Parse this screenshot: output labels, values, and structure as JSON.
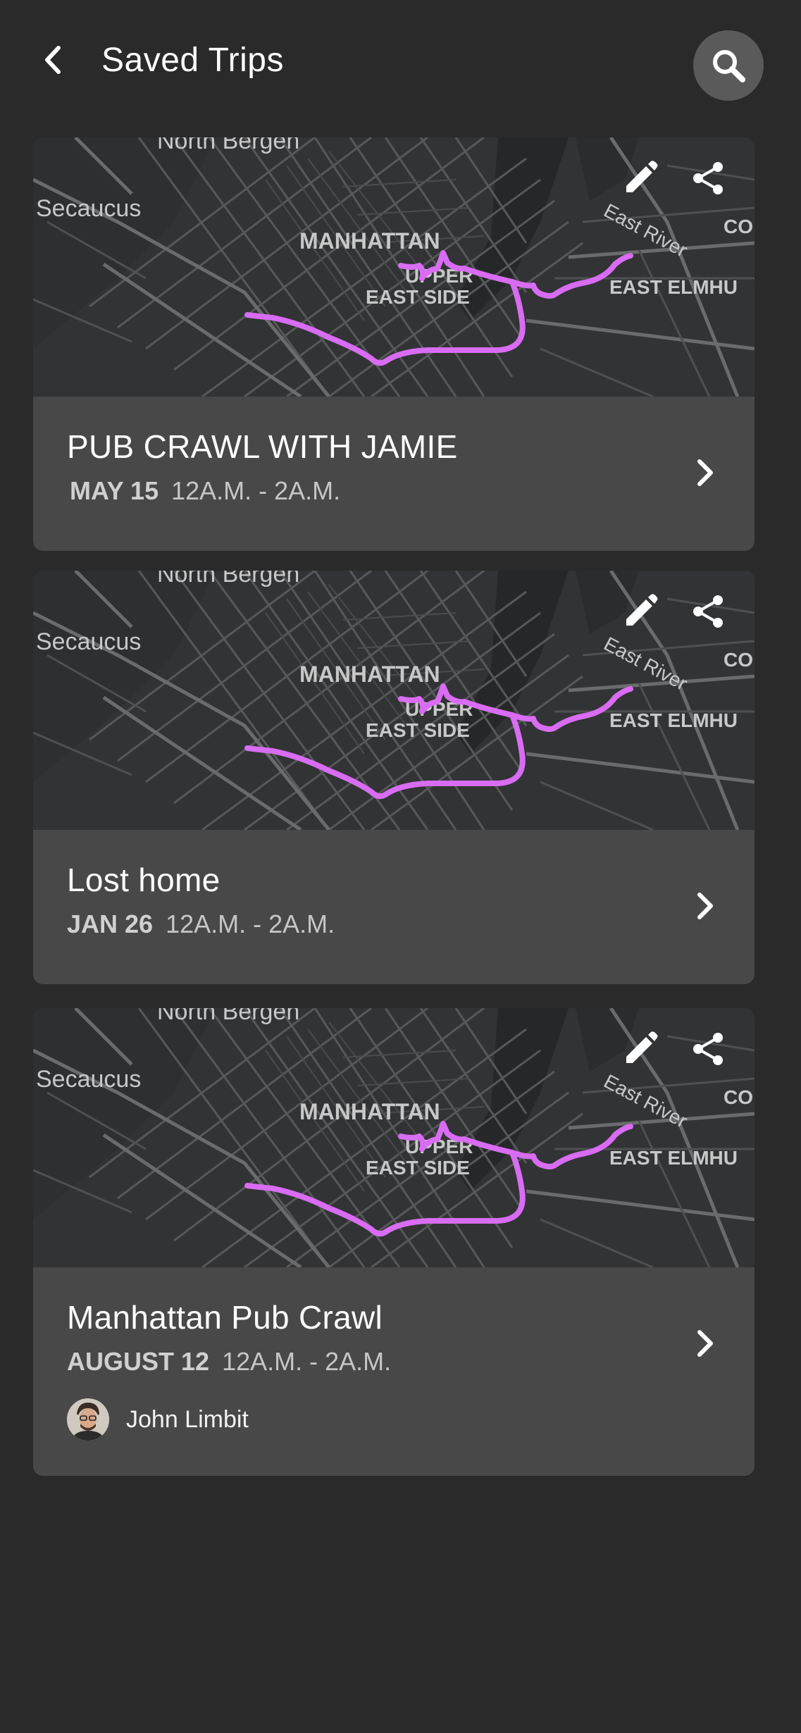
{
  "header": {
    "title": "Saved Trips"
  },
  "map_labels": {
    "north": "North Bergen",
    "west": "Secaucus",
    "borough": "MANHATTAN",
    "neigh_1": "UPPER",
    "neigh_2": "EAST SIDE",
    "river": "East River",
    "east": "EAST ELMHU",
    "edge": "CO"
  },
  "colors": {
    "route": "#d86cf2",
    "background": "#2a2a2a",
    "card": "#484848"
  },
  "trips": [
    {
      "name": "PUB CRAWL WITH JAMIE",
      "day": "MAY 15",
      "time": "12A.M. - 2A.M."
    },
    {
      "name": "Lost home",
      "day": "JAN 26",
      "time": "12A.M. - 2A.M."
    },
    {
      "name": "Manhattan Pub Crawl",
      "day": "AUGUST 12",
      "time": "12A.M. - 2A.M.",
      "owner": "John Limbit"
    }
  ],
  "icons": {
    "back": "chevron-left-icon",
    "search": "search-icon",
    "edit": "pencil-icon",
    "share": "share-icon",
    "open": "chevron-right-icon"
  }
}
